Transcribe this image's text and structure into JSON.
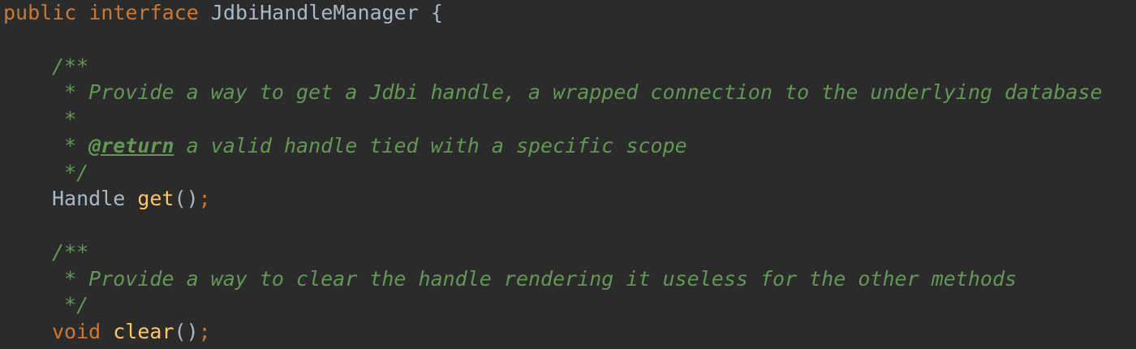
{
  "code": {
    "line1": {
      "kw_public": "public",
      "kw_interface": "interface",
      "name": "JdbiHandleManager",
      "open_brace": "{"
    },
    "doc1": {
      "open": "/**",
      "text": " * Provide a way to get a Jdbi handle, a wrapped connection to the underlying database",
      "blank": " *",
      "return_prefix": " * ",
      "return_tag": "@return",
      "return_text": " a valid handle tied with a specific scope",
      "close": " */"
    },
    "method1": {
      "return_type": "Handle",
      "name": "get",
      "parens": "()",
      "semicolon": ";"
    },
    "doc2": {
      "open": "/**",
      "text": " * Provide a way to clear the handle rendering it useless for the other methods",
      "close": " */"
    },
    "method2": {
      "return_type": "void",
      "name": "clear",
      "parens": "()",
      "semicolon": ";"
    }
  },
  "colors": {
    "background": "#2b2b2b",
    "keyword": "#cc7832",
    "identifier": "#a9b7c6",
    "method": "#ffc66d",
    "javadoc": "#629755"
  }
}
